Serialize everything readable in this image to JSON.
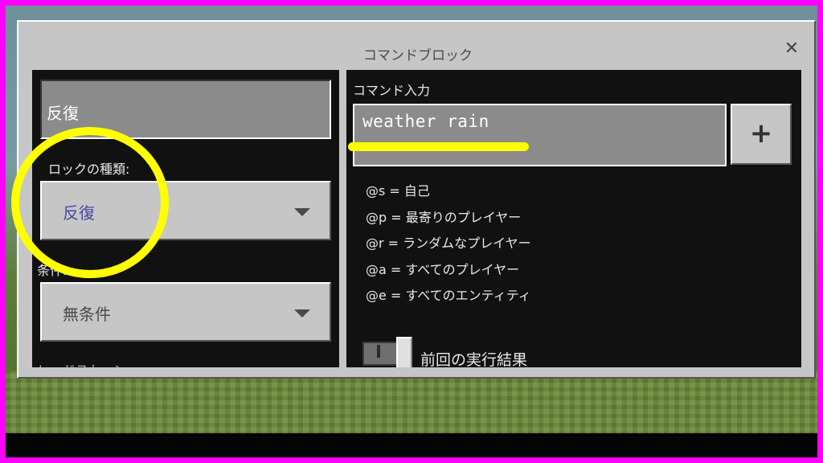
{
  "dialog": {
    "title": "コマンドブロック",
    "close_glyph": "✕"
  },
  "left": {
    "block_type_display": "反復",
    "block_type_label": "ロックの種類:",
    "block_type_value": "反復",
    "condition_label": "条件:",
    "condition_value": "無条件",
    "cut_label": "レッドストーン:"
  },
  "right": {
    "command_label": "コマンド入力",
    "command_value": "weather rain",
    "plus_label": "+",
    "selectors": [
      "@s = 自己",
      "@p = 最寄りのプレイヤー",
      "@r = ランダムなプレイヤー",
      "@a = すべてのプレイヤー",
      "@e = すべてのエンティティ"
    ],
    "previous_output_label": "前回の実行結果"
  },
  "colors": {
    "frame": "#ff00ff",
    "highlight": "#ffff00",
    "panel": "#111111",
    "dialog": "#c6c6c6"
  }
}
